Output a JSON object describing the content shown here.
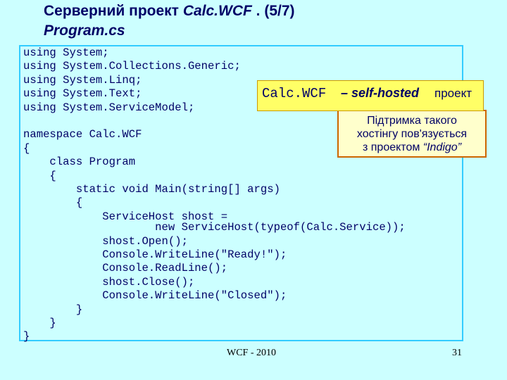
{
  "slide": {
    "title_main": "Серверний проект",
    "title_project": "Calc.WCF",
    "title_counter": ". (5/7)",
    "subtitle": "Program.cs"
  },
  "code_lines": [
    "using System;",
    "using System.Collections.Generic;",
    "using System.Linq;",
    "using System.Text;",
    "using System.ServiceModel;",
    "",
    "namespace Calc.WCF",
    "{",
    "    class Program",
    "    {",
    "        static void Main(string[] args)",
    "        {",
    "            ServiceHost shost =",
    "                    new ServiceHost(typeof(Calc.Service));",
    "            shost.Open();",
    "            Console.WriteLine(\"Ready!\");",
    "            Console.ReadLine();",
    "            shost.Close();",
    "            Console.WriteLine(\"Closed\");",
    "        }",
    "    }",
    "}"
  ],
  "callout": {
    "name": "Calc.WCF",
    "dash_phrase": "– self-hosted",
    "suffix": "проект"
  },
  "callout_note": {
    "line1": "Підтримка такого",
    "line2": "хостінгу пов'язується",
    "line3_prefix": "з проектом ",
    "line3_italic": "“Indigo”"
  },
  "footer": {
    "center": "WCF - 2010",
    "page": "31"
  }
}
